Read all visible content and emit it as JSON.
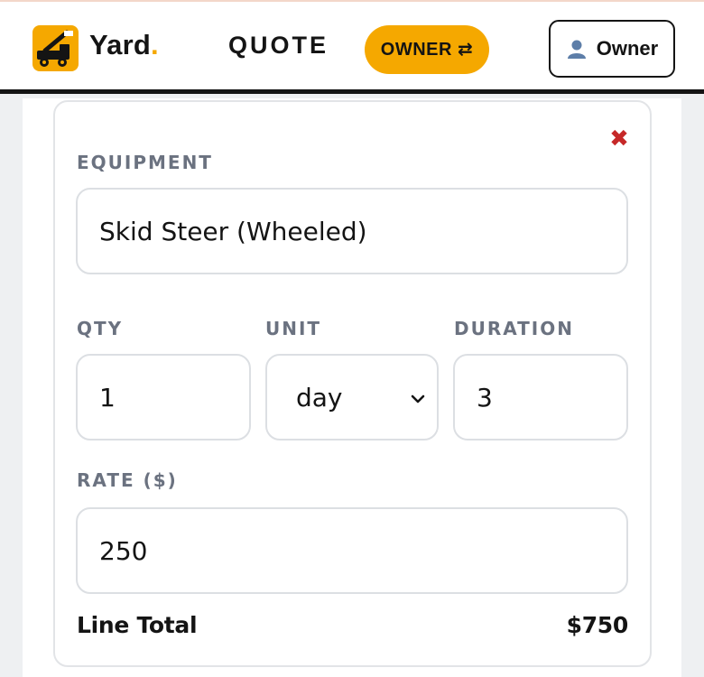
{
  "header": {
    "brand_name": "Yard",
    "brand_dot": ".",
    "section_title": "QUOTE",
    "mode_label": "OWNER",
    "mode_icon": "swap-arrows-icon",
    "user_label": "Owner",
    "user_icon": "user-icon",
    "accent_color": "#f5a800"
  },
  "line_item": {
    "close_icon": "close-icon",
    "close_symbol": "✖",
    "equipment": {
      "label": "EQUIPMENT",
      "value": "Skid Steer (Wheeled)"
    },
    "qty": {
      "label": "QTY",
      "value": "1"
    },
    "unit": {
      "label": "UNIT",
      "value": "day"
    },
    "duration": {
      "label": "DURATION",
      "value": "3"
    },
    "rate": {
      "label": "RATE ($)",
      "value": "250"
    },
    "total": {
      "label": "Line Total",
      "value": "$750"
    }
  }
}
